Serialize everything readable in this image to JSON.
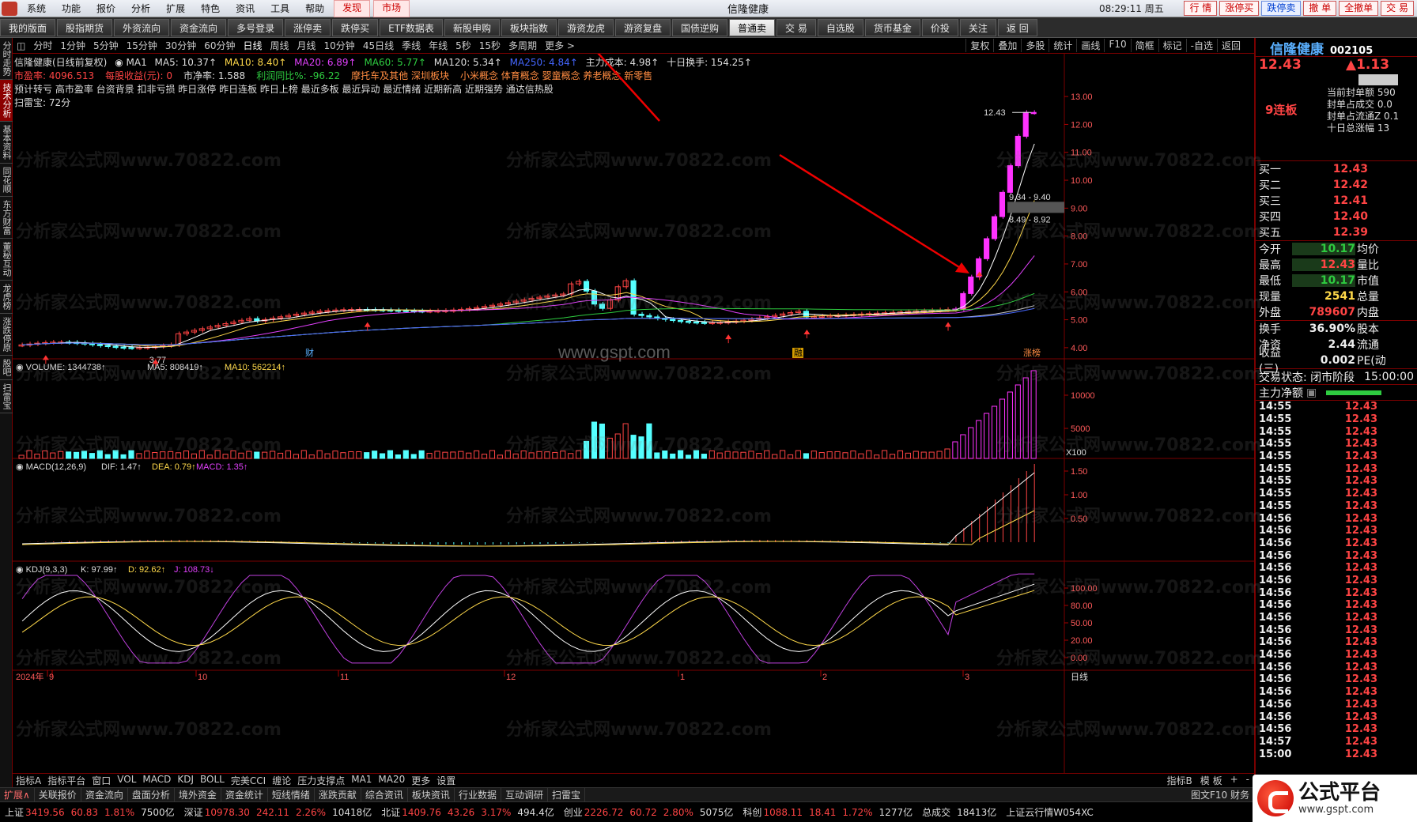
{
  "menubar": {
    "items": [
      "系统",
      "功能",
      "报价",
      "分析",
      "扩展",
      "特色",
      "资讯",
      "工具",
      "帮助"
    ],
    "hot": [
      "发现",
      "市场"
    ],
    "title": "信隆健康",
    "clock": "08:29:11 周五",
    "right_buttons": [
      "行 情",
      "涨停买",
      "跌停卖",
      "撤 单",
      "全撤单",
      "交 易"
    ]
  },
  "toolbar": {
    "items": [
      "我的版面",
      "股指期货",
      "外资流向",
      "资金流向",
      "多号登录",
      "涨停卖",
      "跌停买",
      "ETF数据表",
      "新股申购",
      "板块指数",
      "游资龙虎",
      "游资复盘",
      "国债逆购",
      "普通卖",
      "交 易",
      "自选股",
      "货币基金",
      "价投",
      "关注",
      "返 回"
    ],
    "selected": "普通卖"
  },
  "leftbar": {
    "tabs": [
      "分时走势",
      "技术分析",
      "基本资料",
      "同花顺",
      "东方财富",
      "董秘互动",
      "龙虎榜",
      "涨跌停原",
      "股吧",
      "扫雷宝"
    ],
    "active": "技术分析"
  },
  "periodbar": {
    "items": [
      "分时",
      "1分钟",
      "5分钟",
      "15分钟",
      "30分钟",
      "60分钟",
      "日线",
      "周线",
      "月线",
      "10分钟",
      "45日线",
      "季线",
      "年线",
      "5秒",
      "15秒",
      "多周期",
      "更多 >"
    ],
    "right_tools": [
      "复权",
      "叠加",
      "多股",
      "统计",
      "画线",
      "F10",
      "简框",
      "标记",
      "-自选",
      "返回"
    ]
  },
  "kline_info": {
    "name": "信隆健康(日线前复权)",
    "ma1": "MA1",
    "ma5": "MA5: 10.37↑",
    "ma10": "MA10: 8.40↑",
    "ma20": "MA20: 6.89↑",
    "ma60": "MA60: 5.77↑",
    "ma120": "MA120: 5.34↑",
    "ma250": "MA250: 4.84↑",
    "cost": "主力成本: 4.98↑",
    "turnover10": "十日换手: 154.25↑",
    "line2": [
      "市盈率: 4096.513",
      "每股收益(元): 0",
      "市净率: 1.588",
      "利润同比%: -96.22",
      "摩托车及其他 深圳板块",
      "小米概念 体育概念 婴童概念 养老概念 新零售"
    ],
    "line3": "预计转亏 高市盈率 台资背景 扣非亏损 昨日涨停 昨日连板 昨日上榜 最近多板 最近异动 最近情绪 近期新高 近期强势 通达信热股",
    "line4": "扫雷宝: 72分"
  },
  "chart_data": {
    "type": "candlestick",
    "title": "信隆健康(日线前复权)",
    "price_axis": [
      13.0,
      12.0,
      11.0,
      10.0,
      9.0,
      8.0,
      7.0,
      6.0,
      5.0,
      4.0
    ],
    "price_labels": [
      "13.00",
      "12.00",
      "11.00",
      "10.00",
      "9.00",
      "8.00",
      "7.00",
      "6.00",
      "5.00",
      "4.00"
    ],
    "ylim": [
      3.6,
      13.4
    ],
    "high_label": "12.43",
    "low_label": "3.77",
    "range_labels": [
      "9.34 - 9.40",
      "8.49 - 8.92"
    ],
    "x_labels": [
      "2024年",
      "9",
      "10",
      "11",
      "12",
      "1",
      "2",
      "3"
    ],
    "markers": [
      "财",
      "融",
      "涨榜"
    ],
    "volume": {
      "title": "VOLUME: 1344738↑",
      "ma5": "MA5: 808419↑",
      "ma10": "MA10: 562214↑",
      "axis": [
        "10000",
        "5000"
      ],
      "unit": "X100"
    },
    "macd": {
      "title": "MACD(12,26,9)",
      "dif": "DIF: 1.47↑",
      "dea": "DEA: 0.79↑",
      "macd": "MACD: 1.35↑",
      "axis": [
        "1.50",
        "1.00",
        "0.50"
      ]
    },
    "kdj": {
      "title": "KDJ(9,3,3)",
      "k": "K: 97.99↑",
      "d": "D: 92.62↑",
      "j": "J: 108.73↓",
      "axis": [
        "100.00",
        "80.00",
        "50.00",
        "20.00",
        "0.00"
      ]
    },
    "period_label": "日线",
    "watermark_center": "www.gspt.com",
    "watermark": "分析家公式网www.70822.com"
  },
  "bottom_tabs": {
    "items": [
      "指标A",
      "指标平台",
      "窗口",
      "VOL",
      "MACD",
      "KDJ",
      "BOLL",
      "完美CCI",
      "缠论",
      "压力支撑点",
      "MA1",
      "MA20",
      "更多",
      "设置"
    ],
    "right": [
      "指标B",
      "模 板",
      "+",
      "-"
    ]
  },
  "ext_bar": {
    "items": [
      "扩展∧",
      "关联报价",
      "资金流向",
      "盘面分析",
      "境外资金",
      "资金统计",
      "短线情绪",
      "涨跌贡献",
      "综合资讯",
      "板块资讯",
      "行业数据",
      "互动调研",
      "扫雷宝"
    ],
    "right": "图文F10 财务"
  },
  "index_bar": [
    {
      "name": "上证",
      "val": "3419.56",
      "chg": "60.83",
      "pct": "1.81%",
      "amt": "7500亿"
    },
    {
      "name": "深证",
      "val": "10978.30",
      "chg": "242.11",
      "pct": "2.26%",
      "amt": "10418亿"
    },
    {
      "name": "北证",
      "val": "1409.76",
      "chg": "43.26",
      "pct": "3.17%",
      "amt": "494.4亿"
    },
    {
      "name": "创业",
      "val": "2226.72",
      "chg": "60.72",
      "pct": "2.80%",
      "amt": "5075亿"
    },
    {
      "name": "科创",
      "val": "1088.11",
      "chg": "18.41",
      "pct": "1.72%",
      "amt": "1277亿"
    }
  ],
  "index_tail": {
    "total_label": "总成交",
    "total": "18413亿",
    "cloud": "上证云行情W054XC"
  },
  "right_panel": {
    "name": "信隆健康",
    "code": "002105",
    "last": "12.43",
    "change": "▲1.13",
    "streak": "9连板",
    "limit_rows": [
      "当前封单额 590",
      "封单占成交 0.0",
      "封单占流通Z 0.1",
      "十日总涨幅 13"
    ],
    "bids": [
      {
        "label": "买一",
        "price": "12.43",
        "vol": ""
      },
      {
        "label": "买二",
        "price": "12.42",
        "vol": ""
      },
      {
        "label": "买三",
        "price": "12.41",
        "vol": ""
      },
      {
        "label": "买四",
        "price": "12.40",
        "vol": ""
      },
      {
        "label": "买五",
        "price": "12.39",
        "vol": ""
      }
    ],
    "quote": [
      {
        "l": "今开",
        "v": "10.17",
        "c": "g",
        "l2": "均价"
      },
      {
        "l": "最高",
        "v": "12.43",
        "c": "r",
        "l2": "量比"
      },
      {
        "l": "最低",
        "v": "10.17",
        "c": "g",
        "l2": "市值"
      },
      {
        "l": "现量",
        "v": "2541",
        "c": "y",
        "l2": "总量"
      },
      {
        "l": "外盘",
        "v": "789607",
        "c": "r",
        "l2": "内盘"
      }
    ],
    "quote2": [
      {
        "l": "换手",
        "v": "36.90%",
        "l2": "股本"
      },
      {
        "l": "净资",
        "v": "2.44",
        "l2": "流通"
      },
      {
        "l": "收益(三)",
        "v": "0.002",
        "l2": "PE(动"
      }
    ],
    "status_label": "交易状态: 闭市阶段",
    "status_time": "15:00:00",
    "net_label": "主力净额",
    "ticks": [
      {
        "t": "14:55",
        "p": "12.43"
      },
      {
        "t": "14:55",
        "p": "12.43"
      },
      {
        "t": "14:55",
        "p": "12.43"
      },
      {
        "t": "14:55",
        "p": "12.43"
      },
      {
        "t": "14:55",
        "p": "12.43"
      },
      {
        "t": "14:55",
        "p": "12.43"
      },
      {
        "t": "14:55",
        "p": "12.43"
      },
      {
        "t": "14:55",
        "p": "12.43"
      },
      {
        "t": "14:55",
        "p": "12.43"
      },
      {
        "t": "14:56",
        "p": "12.43"
      },
      {
        "t": "14:56",
        "p": "12.43"
      },
      {
        "t": "14:56",
        "p": "12.43"
      },
      {
        "t": "14:56",
        "p": "12.43"
      },
      {
        "t": "14:56",
        "p": "12.43"
      },
      {
        "t": "14:56",
        "p": "12.43"
      },
      {
        "t": "14:56",
        "p": "12.43"
      },
      {
        "t": "14:56",
        "p": "12.43"
      },
      {
        "t": "14:56",
        "p": "12.43"
      },
      {
        "t": "14:56",
        "p": "12.43"
      },
      {
        "t": "14:56",
        "p": "12.43"
      },
      {
        "t": "14:56",
        "p": "12.43"
      },
      {
        "t": "14:56",
        "p": "12.43"
      },
      {
        "t": "14:56",
        "p": "12.43"
      },
      {
        "t": "14:56",
        "p": "12.43"
      },
      {
        "t": "14:56",
        "p": "12.43"
      },
      {
        "t": "14:56",
        "p": "12.43"
      },
      {
        "t": "14:56",
        "p": "12.43"
      },
      {
        "t": "14:57",
        "p": "12.43"
      },
      {
        "t": "15:00",
        "p": "12.43"
      }
    ]
  },
  "brand": {
    "name": "公式平台",
    "url": "www.gspt.com"
  }
}
